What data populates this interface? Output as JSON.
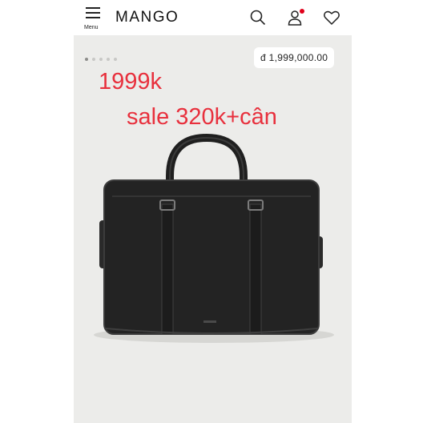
{
  "header": {
    "menu_label": "Menu",
    "brand": "MANGO"
  },
  "gallery": {
    "dot_count": 5,
    "active_index": 0
  },
  "product": {
    "price": "đ 1,999,000.00"
  },
  "annotation": {
    "line1": "1999k",
    "line2": "sale 320k+cân"
  },
  "colors": {
    "annotation": "#e8303d",
    "notification_dot": "#e0001a",
    "background": "#ececea"
  },
  "icons": [
    "menu-icon",
    "search-icon",
    "user-icon",
    "heart-icon"
  ]
}
